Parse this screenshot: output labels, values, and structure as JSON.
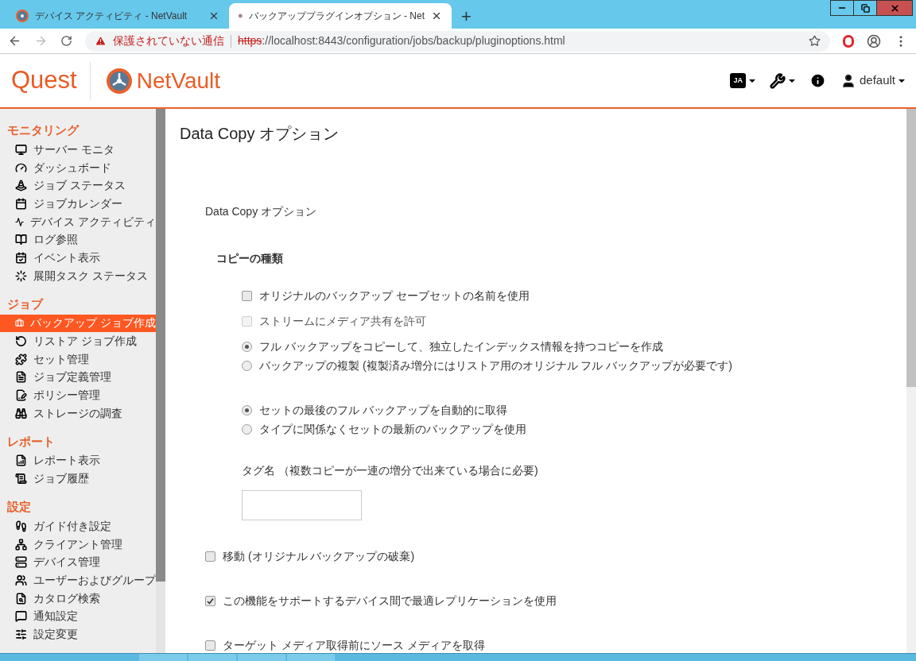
{
  "browser": {
    "tabs": [
      {
        "title": "デバイス アクティビティ - NetVault",
        "selected": false
      },
      {
        "title": "バックアッププラグインオプション - Net",
        "selected": true
      }
    ],
    "new_tab": "+",
    "address": {
      "warning": "保護されていない通信",
      "scheme": "https",
      "rest": "://localhost:8443/configuration/jobs/backup/pluginoptions.html"
    }
  },
  "header": {
    "brand": "Quest",
    "product": "NetVault",
    "language": "JA",
    "user": "default"
  },
  "sidebar": {
    "sections": [
      {
        "title": "モニタリング",
        "items": [
          {
            "label": "サーバー モニタ",
            "selected": false
          },
          {
            "label": "ダッシュボード",
            "selected": false
          },
          {
            "label": "ジョブ ステータス",
            "selected": false
          },
          {
            "label": "ジョブカレンダー",
            "selected": false
          },
          {
            "label": "デバイス アクティビティ",
            "selected": false
          },
          {
            "label": "ログ参照",
            "selected": false
          },
          {
            "label": "イベント表示",
            "selected": false
          },
          {
            "label": "展開タスク ステータス",
            "selected": false
          }
        ]
      },
      {
        "title": "ジョブ",
        "items": [
          {
            "label": "バックアップ ジョブ作成",
            "selected": true
          },
          {
            "label": "リストア ジョブ作成",
            "selected": false
          },
          {
            "label": "セット管理",
            "selected": false
          },
          {
            "label": "ジョブ定義管理",
            "selected": false
          },
          {
            "label": "ポリシー管理",
            "selected": false
          },
          {
            "label": "ストレージの調査",
            "selected": false
          }
        ]
      },
      {
        "title": "レポート",
        "items": [
          {
            "label": "レポート表示",
            "selected": false
          },
          {
            "label": "ジョブ履歴",
            "selected": false
          }
        ]
      },
      {
        "title": "設定",
        "items": [
          {
            "label": "ガイド付き設定",
            "selected": false
          },
          {
            "label": "クライアント管理",
            "selected": false
          },
          {
            "label": "デバイス管理",
            "selected": false
          },
          {
            "label": "ユーザーおよびグループ",
            "selected": false
          },
          {
            "label": "カタログ検索",
            "selected": false
          },
          {
            "label": "通知設定",
            "selected": false
          },
          {
            "label": "設定変更",
            "selected": false
          }
        ]
      }
    ]
  },
  "content": {
    "title": "Data Copy オプション",
    "section": "Data Copy オプション",
    "group": "コピーの種類",
    "option_groups": [
      [
        {
          "kind": "checkbox",
          "label": "オリジナルのバックアップ セーブセットの名前を使用",
          "checked": false,
          "disabled": false
        },
        {
          "kind": "checkbox",
          "label": "ストリームにメディア共有を許可",
          "checked": false,
          "disabled": true
        }
      ],
      [
        {
          "kind": "radio",
          "label": "フル バックアップをコピーして、独立したインデックス情報を持つコピーを作成",
          "checked": true,
          "disabled": false
        },
        {
          "kind": "radio",
          "label": "バックアップの複製 (複製済み増分にはリストア用のオリジナル フル バックアップが必要です)",
          "checked": false,
          "disabled": false
        }
      ],
      [
        {
          "kind": "radio",
          "label": "セットの最後のフル バックアップを自動的に取得",
          "checked": true,
          "disabled": false
        },
        {
          "kind": "radio",
          "label": "タイプに関係なくセットの最新のバックアップを使用",
          "checked": false,
          "disabled": false
        }
      ]
    ],
    "tag": {
      "label": "タグ名 （複数コピーが一連の増分で出来ている場合に必要)"
    },
    "options": [
      {
        "label": "移動 (オリジナル バックアップの破棄)",
        "checked": false
      },
      {
        "label": "この機能をサポートするデバイス間で最適レプリケーションを使用",
        "checked": true
      },
      {
        "label": "ターゲット メディア取得前にソース メディアを取得",
        "checked": false
      }
    ]
  }
}
